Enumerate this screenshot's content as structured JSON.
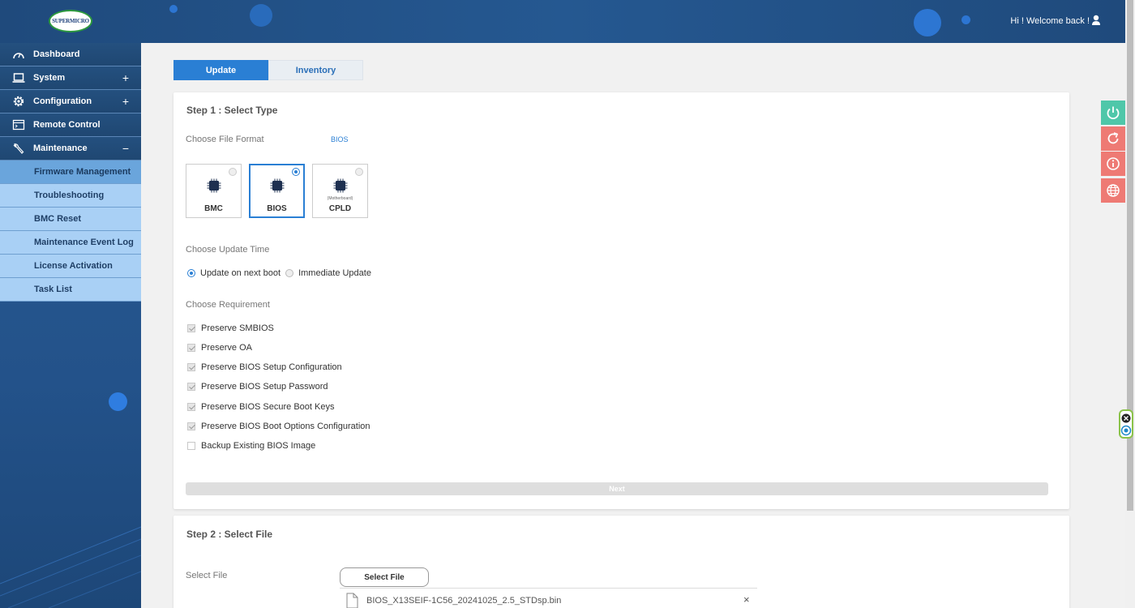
{
  "header": {
    "logo_text": "SUPERMICRO",
    "welcome": "Hi ! Welcome back !"
  },
  "sidebar": {
    "items": [
      {
        "label": "Dashboard",
        "icon": "dashboard-icon",
        "toggle": ""
      },
      {
        "label": "System",
        "icon": "laptop-icon",
        "toggle": "+"
      },
      {
        "label": "Configuration",
        "icon": "gear-icon",
        "toggle": "+"
      },
      {
        "label": "Remote Control",
        "icon": "console-icon",
        "toggle": ""
      },
      {
        "label": "Maintenance",
        "icon": "wrench-icon",
        "toggle": "−"
      }
    ],
    "subitems": [
      {
        "label": "Firmware Management",
        "active": true
      },
      {
        "label": "Troubleshooting"
      },
      {
        "label": "BMC Reset"
      },
      {
        "label": "Maintenance Event Log"
      },
      {
        "label": "License Activation"
      },
      {
        "label": "Task List"
      }
    ]
  },
  "tabs": {
    "update": "Update",
    "inventory": "Inventory",
    "active": "Update"
  },
  "step1": {
    "title": "Step 1 : Select Type",
    "file_format_label": "Choose File Format",
    "file_format_value": "BIOS",
    "chips": [
      {
        "label": "BMC",
        "sub": "",
        "selected": false
      },
      {
        "label": "BIOS",
        "sub": "",
        "selected": true
      },
      {
        "label": "CPLD",
        "sub": "(Motherboard)",
        "selected": false
      }
    ],
    "update_time_label": "Choose Update Time",
    "update_time_options": [
      {
        "label": "Update on next boot",
        "selected": true
      },
      {
        "label": "Immediate Update",
        "selected": false
      }
    ],
    "requirement_label": "Choose Requirement",
    "requirements": [
      {
        "label": "Preserve SMBIOS",
        "checked": true
      },
      {
        "label": "Preserve OA",
        "checked": true
      },
      {
        "label": "Preserve BIOS Setup Configuration",
        "checked": true
      },
      {
        "label": "Preserve BIOS Setup Password",
        "checked": true
      },
      {
        "label": "Preserve BIOS Secure Boot Keys",
        "checked": true
      },
      {
        "label": "Preserve BIOS Boot Options Configuration",
        "checked": true
      },
      {
        "label": "Backup Existing BIOS Image",
        "checked": false
      }
    ],
    "next_label": "Next"
  },
  "step2": {
    "title": "Step 2 : Select File",
    "select_file_label": "Select File",
    "select_file_button": "Select File",
    "file_name": "BIOS_X13SEIF-1C56_20241025_2.5_STDsp.bin",
    "remove_glyph": "×"
  },
  "colors": {
    "accent": "#2a7fd4",
    "header": "#255891",
    "power": "#4fc7a9",
    "alert": "#ee7a74"
  }
}
